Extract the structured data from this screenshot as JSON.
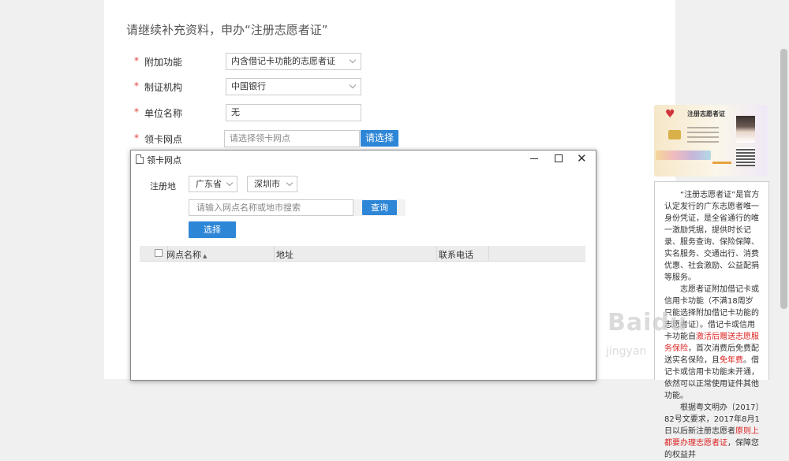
{
  "page": {
    "heading": "请继续补充资料，申办“注册志愿者证”"
  },
  "form": {
    "required_mark": "*",
    "rows": [
      {
        "label": "附加功能",
        "value": "内含借记卡功能的志愿者证"
      },
      {
        "label": "制证机构",
        "value": "中国银行"
      },
      {
        "label": "单位名称",
        "value": "无"
      },
      {
        "label": "领卡网点",
        "placeholder": "请选择领卡网点"
      }
    ],
    "choose_button": "请选择"
  },
  "modal": {
    "title": "领卡网点",
    "close_glyph": "✕",
    "register_label": "注册地",
    "province": "广东省",
    "city": "深圳市",
    "search_placeholder": "请输入网点名称或地市搜索",
    "query_button": "查询",
    "select_button": "选择",
    "columns": [
      "网点名称",
      "地址",
      "联系电话"
    ],
    "sort_glyph": "▲"
  },
  "sidebar": {
    "card": {
      "title": "注册志愿者证",
      "icon": "heart-logo-icon"
    },
    "info": {
      "p1": "“注册志愿者证”是官方认定发行的广东志愿者唯一身份凭证，是全省通行的唯一激励凭据，提供时长记录、服务查询、保险保障、实名服务、交通出行、消费优惠、社会激励、公益配捐等服务。",
      "p2_a": "志愿者证附加借记卡或信用卡功能（不满18周岁只能选择附加借记卡功能的志愿者证）。借记卡或信用卡功能自",
      "p2_hl1": "激活后赠送志愿服务保险",
      "p2_b": "，首次消费后免费配送实名保险，且",
      "p2_hl2": "免年费",
      "p2_c": "。借记卡或信用卡功能未开通，依然可以正常使用证件其他功能。",
      "p3_a": "根据粤文明办〔2017〕82号文要求，2017年8月1日以后新注册志愿者",
      "p3_hl": "原则上都要办理志愿者证",
      "p3_b": "，保障您的权益并"
    },
    "watermark": "Baidu",
    "watermark_sub": "jingyan"
  },
  "colors": {
    "accent": "#2e86d6",
    "required": "#e0443e",
    "highlight": "#dd2222"
  }
}
